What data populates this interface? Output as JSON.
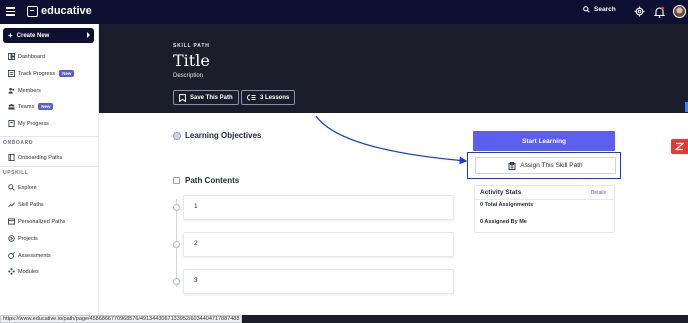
{
  "topbar": {
    "logo_text": "educative",
    "search_label": "Search"
  },
  "sidebar": {
    "create_label": "Create New",
    "items": [
      {
        "label": "Dashboard",
        "icon": "dashboard-icon"
      },
      {
        "label": "Track Progress",
        "icon": "progress-icon",
        "badge": "New"
      },
      {
        "label": "Members",
        "icon": "members-icon"
      },
      {
        "label": "Teams",
        "icon": "teams-icon",
        "badge": "New"
      },
      {
        "label": "My Progress",
        "icon": "my-progress-icon"
      }
    ],
    "section_onboard": "ONBOARD",
    "onboard_items": [
      {
        "label": "Onboarding Paths",
        "icon": "onboarding-icon"
      }
    ],
    "section_upskill": "UPSKILL",
    "upskill_items": [
      {
        "label": "Explore",
        "icon": "search-icon"
      },
      {
        "label": "Skill Paths",
        "icon": "trend-icon"
      },
      {
        "label": "Personalized Paths",
        "icon": "personalized-icon"
      },
      {
        "label": "Projects",
        "icon": "projects-icon"
      },
      {
        "label": "Assessments",
        "icon": "assessments-icon"
      },
      {
        "label": "Modules",
        "icon": "modules-icon"
      }
    ]
  },
  "hero": {
    "eyebrow": "SKILL PATH",
    "title": "Title",
    "description": "Description",
    "save_label": "Save This Path",
    "lessons_label": "3 Lessons"
  },
  "main": {
    "objectives_heading": "Learning Objectives",
    "contents_heading": "Path Contents",
    "items": [
      "1",
      "2",
      "3"
    ]
  },
  "panel": {
    "start_label": "Start Learning",
    "assign_label": "Assign This Skill Path",
    "stats_title": "Activity Stats",
    "details_label": "Details",
    "total_assignments": "0 Total Assignments",
    "assigned_by_me": "0 Assigned By Me"
  },
  "status": {
    "url": "https://www.educative.io/path/page/4586866770968576/4913443067133952/6034404717887488"
  },
  "colors": {
    "nav_bg": "#0d1030",
    "hero_bg": "#1b1d2b",
    "accent": "#5c5ef0",
    "highlight_border": "#1e3ad8",
    "badge": "#5b5bd6"
  }
}
